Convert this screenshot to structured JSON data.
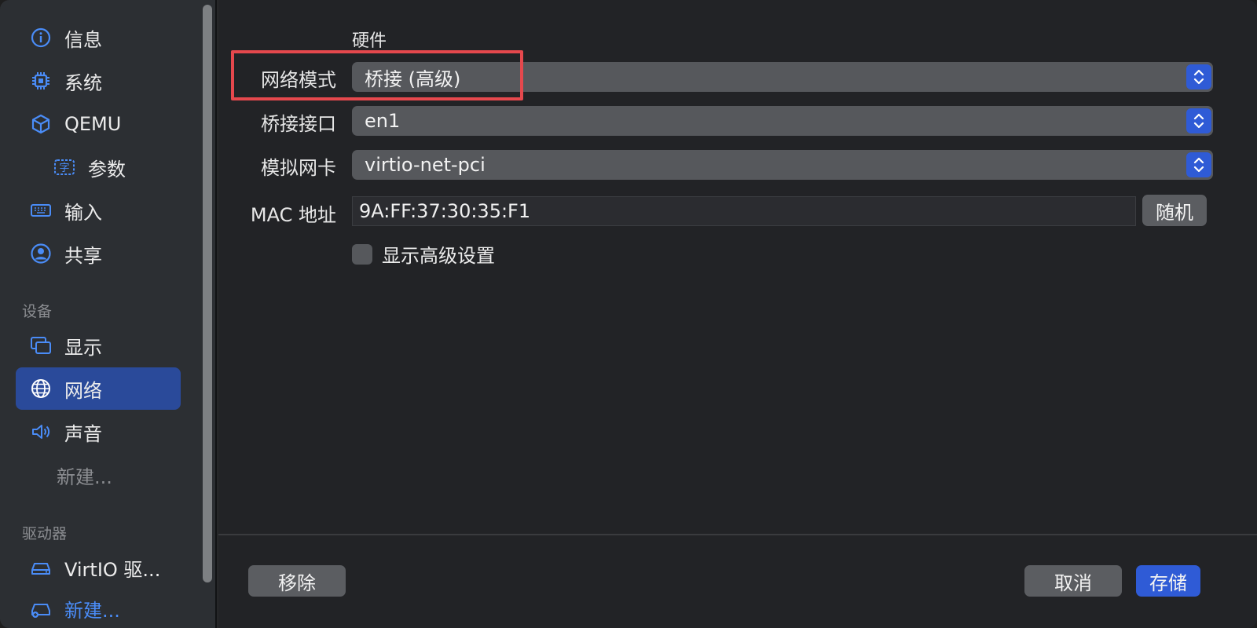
{
  "sidebar": {
    "items": [
      {
        "label": "信息",
        "icon": "info-icon"
      },
      {
        "label": "系统",
        "icon": "cpu-icon"
      },
      {
        "label": "QEMU",
        "icon": "cube-icon"
      },
      {
        "label": "参数",
        "icon": "text-format-icon"
      },
      {
        "label": "输入",
        "icon": "keyboard-icon"
      },
      {
        "label": "共享",
        "icon": "person-circle-icon"
      }
    ],
    "devices_section": "设备",
    "devices": [
      {
        "label": "显示",
        "icon": "display-icon"
      },
      {
        "label": "网络",
        "icon": "globe-icon",
        "selected": true
      },
      {
        "label": "声音",
        "icon": "speaker-icon"
      },
      {
        "label": "新建..."
      }
    ],
    "drives_section": "驱动器",
    "drives": [
      {
        "label": "VirtIO 驱...",
        "icon": "drive-icon"
      },
      {
        "label": "新建...",
        "icon": "drive-add-icon"
      }
    ]
  },
  "main": {
    "section_title": "硬件",
    "network_mode": {
      "label": "网络模式",
      "value": "桥接 (高级)"
    },
    "bridge_interface": {
      "label": "桥接接口",
      "value": "en1"
    },
    "emulated_nic": {
      "label": "模拟网卡",
      "value": "virtio-net-pci"
    },
    "mac_address": {
      "label": "MAC 地址",
      "value": "9A:FF:37:30:35:F1",
      "random_label": "随机"
    },
    "show_advanced": {
      "label": "显示高级设置",
      "checked": false
    }
  },
  "footer": {
    "remove_label": "移除",
    "cancel_label": "取消",
    "save_label": "存储"
  },
  "colors": {
    "accent": "#2f5bd6",
    "selection": "#2a4a9a",
    "highlight_box": "#e5484d"
  }
}
